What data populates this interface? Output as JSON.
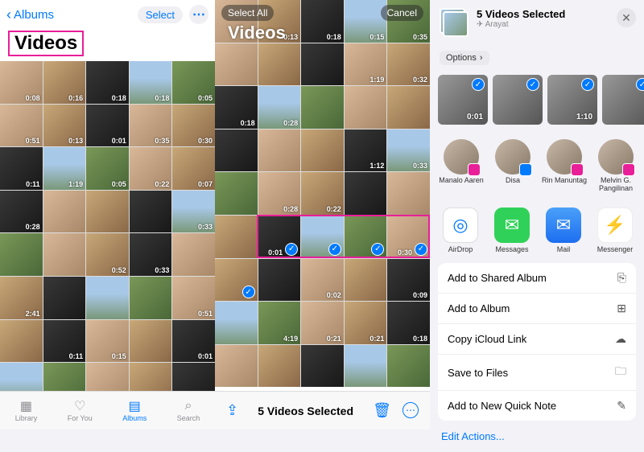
{
  "left": {
    "back_label": "Albums",
    "select_label": "Select",
    "title": "Videos",
    "tabs": [
      {
        "label": "Library"
      },
      {
        "label": "For You"
      },
      {
        "label": "Albums"
      },
      {
        "label": "Search"
      }
    ],
    "cells": [
      [
        "0:08",
        "0:16",
        "0:18",
        "0:18",
        "0:05"
      ],
      [
        "0:51",
        "0:13",
        "0:01",
        "0:35",
        "0:30"
      ],
      [
        "0:11",
        "1:19",
        "0:05",
        "0:22",
        "0:07"
      ],
      [
        "0:28",
        "",
        "",
        "",
        "0:33"
      ],
      [
        "",
        "",
        "0:52",
        "0:33",
        ""
      ],
      [
        "2:41",
        "",
        "",
        "",
        "0:51"
      ],
      [
        "",
        "0:11",
        "0:15",
        "",
        "0:01"
      ],
      [
        "",
        "",
        "",
        "",
        ""
      ]
    ]
  },
  "mid": {
    "select_all": "Select All",
    "cancel": "Cancel",
    "title": "Videos",
    "count_label": "5 Videos Selected",
    "cells": [
      [
        "",
        "0:13",
        "0:18",
        "0:15",
        "0:35"
      ],
      [
        "",
        "",
        "",
        "1:19",
        "0:32"
      ],
      [
        "0:18",
        "0:28",
        "",
        "",
        ""
      ],
      [
        "",
        "",
        "",
        "1:12",
        "0:33"
      ],
      [
        "",
        "0:28",
        "0:22",
        "",
        ""
      ],
      [
        "",
        "0:01",
        "",
        "",
        "0:30"
      ],
      [
        "",
        "",
        "0:02",
        "",
        "0:09"
      ],
      [
        "",
        "4:19",
        "0:21",
        "0:21",
        "0:18"
      ],
      [
        "",
        "",
        "",
        "",
        ""
      ]
    ],
    "selected_row": 5,
    "selected_cols": [
      1,
      2,
      3,
      4
    ],
    "extra_selected": {
      "row": 6,
      "col": 0
    }
  },
  "right": {
    "header_title": "5 Videos Selected",
    "header_loc": "Arayat",
    "options_label": "Options",
    "strip": [
      {
        "dur": "0:01"
      },
      {
        "dur": ""
      },
      {
        "dur": "1:10"
      },
      {
        "dur": ""
      }
    ],
    "contacts": [
      {
        "name": "Manalo Aaren",
        "badge": "pink"
      },
      {
        "name": "Disa",
        "badge": "blue"
      },
      {
        "name": "Rin Manuntag",
        "badge": "pink"
      },
      {
        "name": "Melvin G. Pangilinan",
        "badge": "pink"
      }
    ],
    "apps": [
      {
        "name": "AirDrop",
        "cls": "ic-airdrop",
        "glyph": "◎"
      },
      {
        "name": "Messages",
        "cls": "ic-msg",
        "glyph": "✉"
      },
      {
        "name": "Mail",
        "cls": "ic-mail",
        "glyph": "✉"
      },
      {
        "name": "Messenger",
        "cls": "ic-mess",
        "glyph": "⚡"
      }
    ],
    "actions": [
      {
        "label": "Add to Shared Album",
        "icon": "⎘"
      },
      {
        "label": "Add to Album",
        "icon": "⊞"
      },
      {
        "label": "Copy iCloud Link",
        "icon": "☁"
      },
      {
        "label": "Save to Files",
        "icon": "🗀"
      },
      {
        "label": "Add to New Quick Note",
        "icon": "✎"
      }
    ],
    "edit_actions": "Edit Actions..."
  }
}
